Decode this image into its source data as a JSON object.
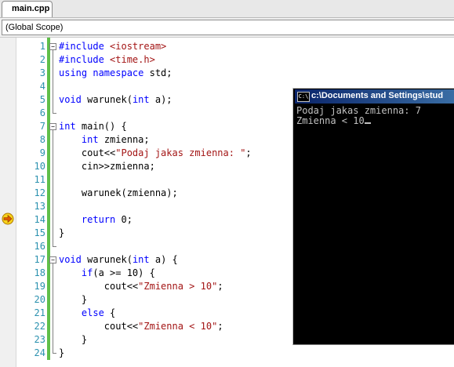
{
  "tab": {
    "label": "main.cpp"
  },
  "scope": {
    "label": "(Global Scope)"
  },
  "editor": {
    "lines": [
      {
        "n": "1",
        "parts": [
          [
            "kw",
            "#include "
          ],
          [
            "str",
            "<iostream>"
          ]
        ]
      },
      {
        "n": "2",
        "parts": [
          [
            "kw",
            "#include "
          ],
          [
            "str",
            "<time.h>"
          ]
        ]
      },
      {
        "n": "3",
        "parts": [
          [
            "kw",
            "using namespace"
          ],
          [
            "txt",
            " std;"
          ]
        ]
      },
      {
        "n": "4",
        "parts": []
      },
      {
        "n": "5",
        "parts": [
          [
            "kw",
            "void"
          ],
          [
            "txt",
            " warunek("
          ],
          [
            "kw",
            "int"
          ],
          [
            "txt",
            " a);"
          ]
        ]
      },
      {
        "n": "6",
        "parts": []
      },
      {
        "n": "7",
        "parts": [
          [
            "kw",
            "int"
          ],
          [
            "txt",
            " main() {"
          ]
        ]
      },
      {
        "n": "8",
        "parts": [
          [
            "txt",
            "    "
          ],
          [
            "kw",
            "int"
          ],
          [
            "txt",
            " zmienna;"
          ]
        ]
      },
      {
        "n": "9",
        "parts": [
          [
            "txt",
            "    cout<<"
          ],
          [
            "str",
            "\"Podaj jakas zmienna: \""
          ],
          [
            "txt",
            ";"
          ]
        ]
      },
      {
        "n": "10",
        "parts": [
          [
            "txt",
            "    cin>>zmienna;"
          ]
        ]
      },
      {
        "n": "11",
        "parts": []
      },
      {
        "n": "12",
        "parts": [
          [
            "txt",
            "    warunek(zmienna);"
          ]
        ]
      },
      {
        "n": "13",
        "parts": []
      },
      {
        "n": "14",
        "parts": [
          [
            "txt",
            "    "
          ],
          [
            "kw",
            "return"
          ],
          [
            "txt",
            " 0;"
          ]
        ]
      },
      {
        "n": "15",
        "parts": [
          [
            "txt",
            "}"
          ]
        ]
      },
      {
        "n": "16",
        "parts": []
      },
      {
        "n": "17",
        "parts": [
          [
            "kw",
            "void"
          ],
          [
            "txt",
            " warunek("
          ],
          [
            "kw",
            "int"
          ],
          [
            "txt",
            " a) {"
          ]
        ]
      },
      {
        "n": "18",
        "parts": [
          [
            "txt",
            "    "
          ],
          [
            "kw",
            "if"
          ],
          [
            "txt",
            "(a >= 10) {"
          ]
        ]
      },
      {
        "n": "19",
        "parts": [
          [
            "txt",
            "        cout<<"
          ],
          [
            "str",
            "\"Zmienna > 10\""
          ],
          [
            "txt",
            ";"
          ]
        ]
      },
      {
        "n": "20",
        "parts": [
          [
            "txt",
            "    }"
          ]
        ]
      },
      {
        "n": "21",
        "parts": [
          [
            "txt",
            "    "
          ],
          [
            "kw",
            "else"
          ],
          [
            "txt",
            " {"
          ]
        ]
      },
      {
        "n": "22",
        "parts": [
          [
            "txt",
            "        cout<<"
          ],
          [
            "str",
            "\"Zmienna < 10\""
          ],
          [
            "txt",
            ";"
          ]
        ]
      },
      {
        "n": "23",
        "parts": [
          [
            "txt",
            "    }"
          ]
        ]
      },
      {
        "n": "24",
        "parts": [
          [
            "txt",
            "}"
          ]
        ]
      }
    ],
    "current_line": "14",
    "icons": {
      "breakpoint_arrow": "current-statement-arrow-icon"
    }
  },
  "console": {
    "title": "c:\\Documents and Settings\\stud",
    "icon_text": "C:\\",
    "output": [
      "Podaj jakas zmienna: 7",
      "Zmienna < 10"
    ]
  },
  "colors": {
    "keyword": "#0000ff",
    "string": "#a31515",
    "line_number": "#2b91af",
    "change_bar": "#5fbf4a",
    "console_title": "#0a246a"
  }
}
